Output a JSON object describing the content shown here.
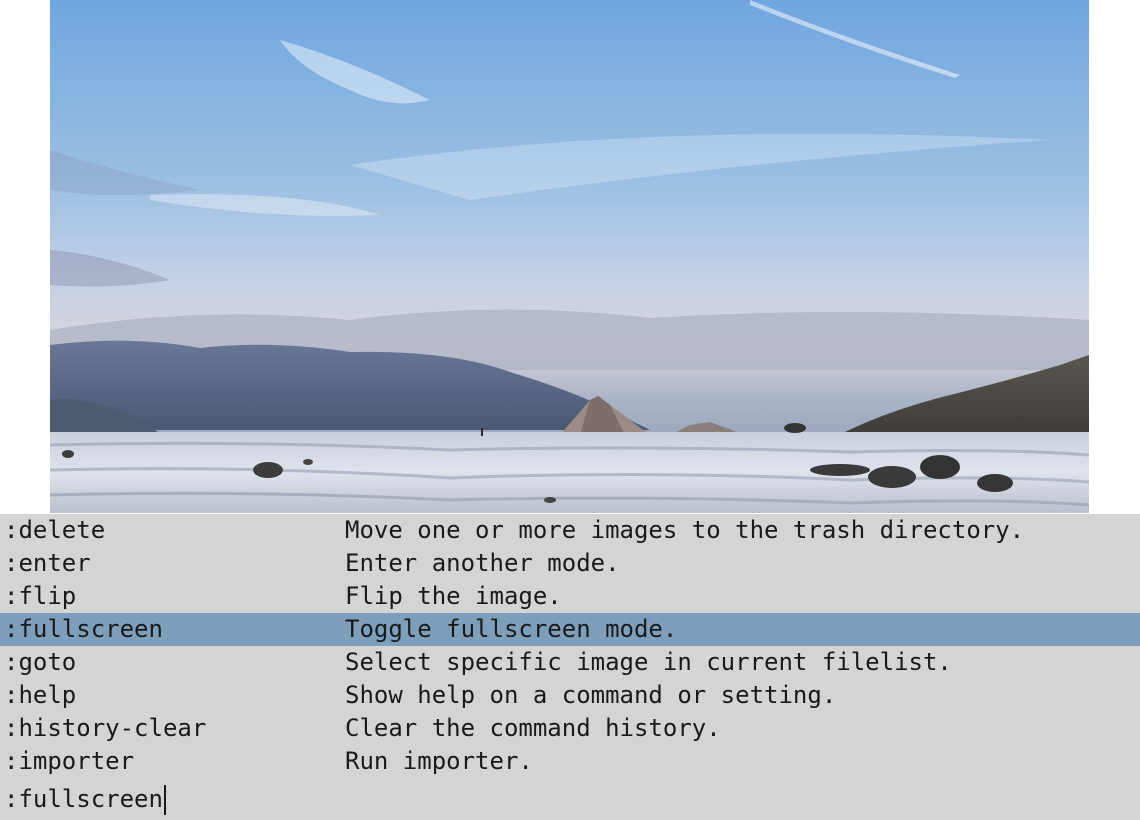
{
  "image": {
    "description_icon": "landscape-photo"
  },
  "completions": [
    {
      "command": ":delete",
      "description": "Move one or more images to the trash directory.",
      "selected": false
    },
    {
      "command": ":enter",
      "description": "Enter another mode.",
      "selected": false
    },
    {
      "command": ":flip",
      "description": "Flip the image.",
      "selected": false
    },
    {
      "command": ":fullscreen",
      "description": "Toggle fullscreen mode.",
      "selected": true
    },
    {
      "command": ":goto",
      "description": "Select specific image in current filelist.",
      "selected": false
    },
    {
      "command": ":help",
      "description": "Show help on a command or setting.",
      "selected": false
    },
    {
      "command": ":history-clear",
      "description": "Clear the command history.",
      "selected": false
    },
    {
      "command": ":importer",
      "description": "Run importer.",
      "selected": false
    }
  ],
  "commandline": {
    "value": ":fullscreen"
  },
  "colors": {
    "completion_bg": "#d4d4d4",
    "selected_bg": "#7d9fbc",
    "text": "#1a1a1a"
  }
}
